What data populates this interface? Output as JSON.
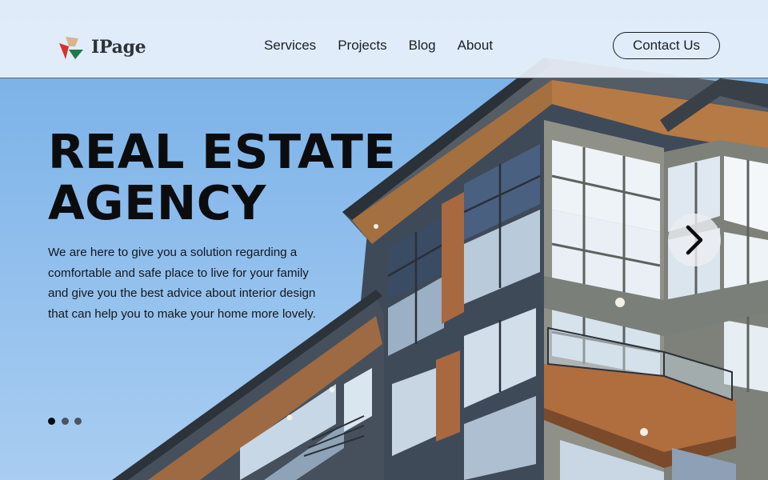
{
  "brand": {
    "name": "IPage"
  },
  "nav": {
    "items": [
      "Services",
      "Projects",
      "Blog",
      "About"
    ]
  },
  "contact_button": {
    "label": "Contact Us"
  },
  "hero": {
    "title_line1": "REAL ESTATE",
    "title_line2": "AGENCY",
    "description": "We are here to give you a solution regarding a comfortable and safe place to live for your family and give you the best advice about interior design that can help you to make your home more lovely."
  },
  "carousel": {
    "slides": 3,
    "active": 0,
    "next_icon": "chevron-right-icon"
  },
  "colors": {
    "text": "#0b0c0e",
    "nav_background": "#e8f0fa",
    "sky": "#8cbcec",
    "wood": "#b06d3e"
  }
}
